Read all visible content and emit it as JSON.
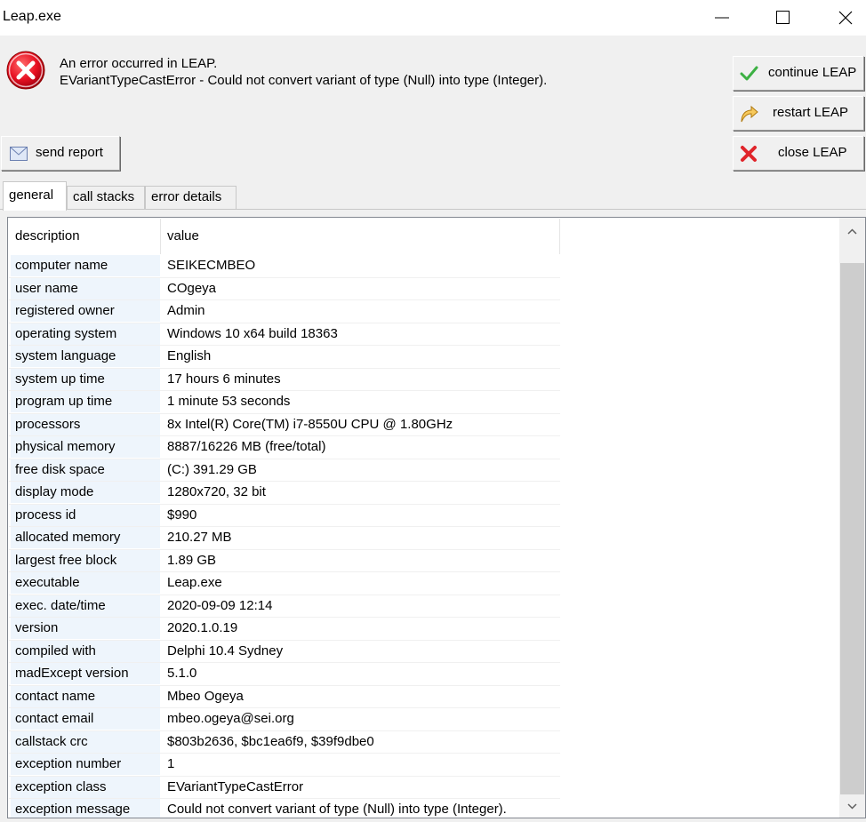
{
  "window": {
    "title": "Leap.exe"
  },
  "error": {
    "line1": "An error occurred in LEAP.",
    "line2": "EVariantTypeCastError - Could not convert variant of type (Null) into type (Integer)."
  },
  "buttons": {
    "continue": "continue LEAP",
    "restart": "restart LEAP",
    "close": "close LEAP",
    "send_report": "send report"
  },
  "tabs": [
    "general",
    "call stacks",
    "error details"
  ],
  "table": {
    "headers": [
      "description",
      "value"
    ],
    "rows": [
      {
        "description": "computer name",
        "value": "SEIKECMBEO"
      },
      {
        "description": "user name",
        "value": "COgeya"
      },
      {
        "description": "registered owner",
        "value": "Admin"
      },
      {
        "description": "operating system",
        "value": "Windows 10 x64 build 18363"
      },
      {
        "description": "system language",
        "value": "English"
      },
      {
        "description": "system up time",
        "value": "17 hours 6 minutes"
      },
      {
        "description": "program up time",
        "value": "1 minute 53 seconds"
      },
      {
        "description": "processors",
        "value": "8x Intel(R) Core(TM) i7-8550U CPU @ 1.80GHz"
      },
      {
        "description": "physical memory",
        "value": "8887/16226 MB (free/total)"
      },
      {
        "description": "free disk space",
        "value": "(C:) 391.29 GB"
      },
      {
        "description": "display mode",
        "value": "1280x720, 32 bit"
      },
      {
        "description": "process id",
        "value": "$990"
      },
      {
        "description": "allocated memory",
        "value": "210.27 MB"
      },
      {
        "description": "largest free block",
        "value": "1.89 GB"
      },
      {
        "description": "executable",
        "value": "Leap.exe"
      },
      {
        "description": "exec. date/time",
        "value": "2020-09-09 12:14"
      },
      {
        "description": "version",
        "value": "2020.1.0.19"
      },
      {
        "description": "compiled with",
        "value": "Delphi 10.4 Sydney"
      },
      {
        "description": "madExcept version",
        "value": "5.1.0"
      },
      {
        "description": "contact name",
        "value": "Mbeo Ogeya"
      },
      {
        "description": "contact email",
        "value": "mbeo.ogeya@sei.org"
      },
      {
        "description": "callstack crc",
        "value": "$803b2636, $bc1ea6f9, $39f9dbe0"
      },
      {
        "description": "exception number",
        "value": "1"
      },
      {
        "description": "exception class",
        "value": "EVariantTypeCastError"
      },
      {
        "description": "exception message",
        "value": "Could not convert variant of type (Null) into type (Integer)."
      }
    ]
  },
  "colors": {
    "error_red": "#e81123",
    "check_green": "#3cb043",
    "row_highlight": "#eef5fc",
    "window_bg": "#f0f0f0"
  },
  "icons": {
    "error": "error-circle-x-icon",
    "continue": "check-icon",
    "restart": "restart-arrow-icon",
    "close": "red-x-icon",
    "send": "envelope-icon"
  }
}
